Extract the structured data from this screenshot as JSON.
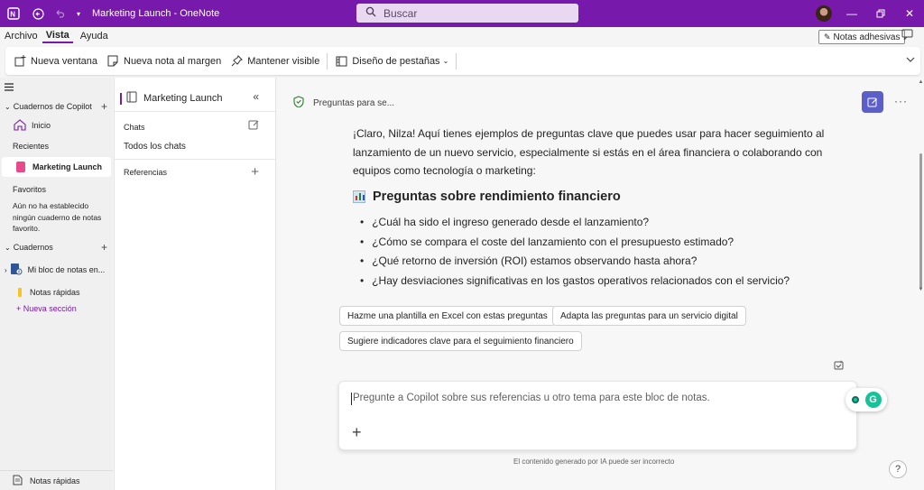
{
  "window": {
    "title": "Marketing Launch  -  OneNote",
    "search_placeholder": "Buscar"
  },
  "menu": {
    "items": [
      "Archivo",
      "Vista",
      "Ayuda"
    ],
    "active": "Vista",
    "sticky_notes": "Notas adhesivas"
  },
  "ribbon": {
    "new_window": "Nueva ventana",
    "margin_note": "Nueva nota al margen",
    "keep_visible": "Mantener visible",
    "tab_layout": "Diseño de pestañas"
  },
  "leftnav": {
    "copilot_notebooks": "Cuadernos de Copilot",
    "home": "Inicio",
    "recent": "Recientes",
    "recent_item": "Marketing Launch",
    "favorites": "Favoritos",
    "no_favorite": "Aún no ha establecido ningún cuaderno de notas favorito.",
    "notebooks": "Cuadernos",
    "my_notebook": "Mi bloc de notas en...",
    "quick_notes": "Notas rápidas",
    "new_section": "+ Nueva sección",
    "bottom_quick_notes": "Notas rápidas"
  },
  "midpanel": {
    "title": "Marketing Launch",
    "chats": "Chats",
    "all_chats": "Todos los chats",
    "references": "Referencias"
  },
  "chat": {
    "header": "Preguntas para se...",
    "intro": "¡Claro, Nilza! Aquí tienes ejemplos de preguntas clave que puedes usar para hacer seguimiento al lanzamiento de un nuevo servicio, especialmente si estás en el área financiera o colaborando con equipos como tecnología o marketing:",
    "section_title": "Preguntas sobre rendimiento financiero",
    "bullets": [
      "¿Cuál ha sido el ingreso generado desde el lanzamiento?",
      "¿Cómo se compara el coste del lanzamiento con el presupuesto estimado?",
      "¿Qué retorno de inversión (ROI) estamos observando hasta ahora?",
      "¿Hay desviaciones significativas en los gastos operativos relacionados con el servicio?"
    ],
    "suggestions": [
      "Hazme una plantilla en Excel con estas preguntas",
      "Adapta las preguntas para un servicio digital",
      "Sugiere indicadores clave para el seguimiento financiero"
    ],
    "composer_placeholder": "Pregunte a Copilot sobre sus referencias u otro tema para este bloc de notas.",
    "disclaimer": "El contenido generado por IA puede ser incorrecto",
    "help": "?"
  },
  "colors": {
    "brand": "#7719aa",
    "accent_button": "#5b5fc7",
    "grammarly": "#15c39a"
  }
}
